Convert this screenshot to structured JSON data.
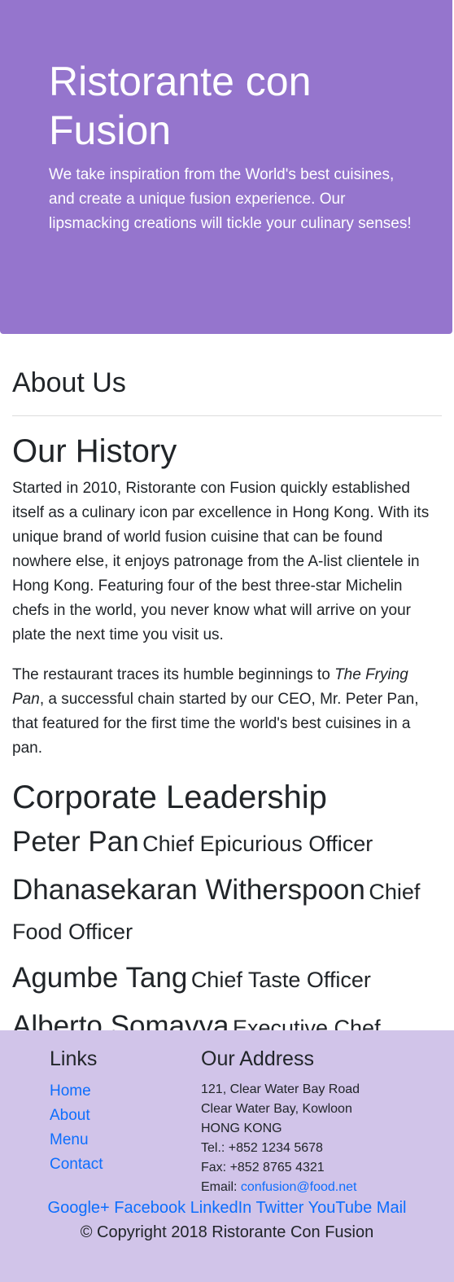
{
  "jumbotron": {
    "title": "Ristorante con Fusion",
    "tagline": "We take inspiration from the World's best cuisines, and create a unique fusion experience. Our lipsmacking creations will tickle your culinary senses!"
  },
  "about": {
    "title": "About Us",
    "history_title": "Our History",
    "history_p1": "Started in 2010, Ristorante con Fusion quickly established itself as a culinary icon par excellence in Hong Kong. With its unique brand of world fusion cuisine that can be found nowhere else, it enjoys patronage from the A-list clientele in Hong Kong. Featuring four of the best three-star Michelin chefs in the world, you never know what will arrive on your plate the next time you visit us.",
    "history_p2_before": "The restaurant traces its humble beginnings to ",
    "history_p2_italic": "The Frying Pan",
    "history_p2_after": ", a successful chain started by our CEO, Mr. Peter Pan, that featured for the first time the world's best cuisines in a pan.",
    "leadership_title": "Corporate Leadership",
    "leaders": [
      {
        "name": "Peter Pan",
        "role": "Chief Epicurious Officer"
      },
      {
        "name": "Dhanasekaran Witherspoon",
        "role": "Chief Food Officer"
      },
      {
        "name": "Agumbe Tang",
        "role": "Chief Taste Officer"
      },
      {
        "name": "Alberto Somayya",
        "role": "Executive Chef"
      }
    ]
  },
  "footer": {
    "links_title": "Links",
    "links": [
      "Home",
      "About",
      "Menu",
      "Contact"
    ],
    "address_title": "Our Address",
    "address_lines": [
      "121, Clear Water Bay Road",
      "Clear Water Bay, Kowloon",
      "HONG KONG",
      "Tel.: +852 1234 5678",
      "Fax: +852 8765 4321"
    ],
    "email_label": "Email: ",
    "email": "confusion@food.net",
    "social": [
      "Google+",
      "Facebook",
      "LinkedIn",
      "Twitter",
      "YouTube",
      "Mail"
    ],
    "copyright": "© Copyright 2018 Ristorante Con Fusion"
  },
  "colors": {
    "jumbotron_bg": "#9575cd",
    "footer_bg": "#d1c4e9",
    "link": "#0d6efd"
  }
}
